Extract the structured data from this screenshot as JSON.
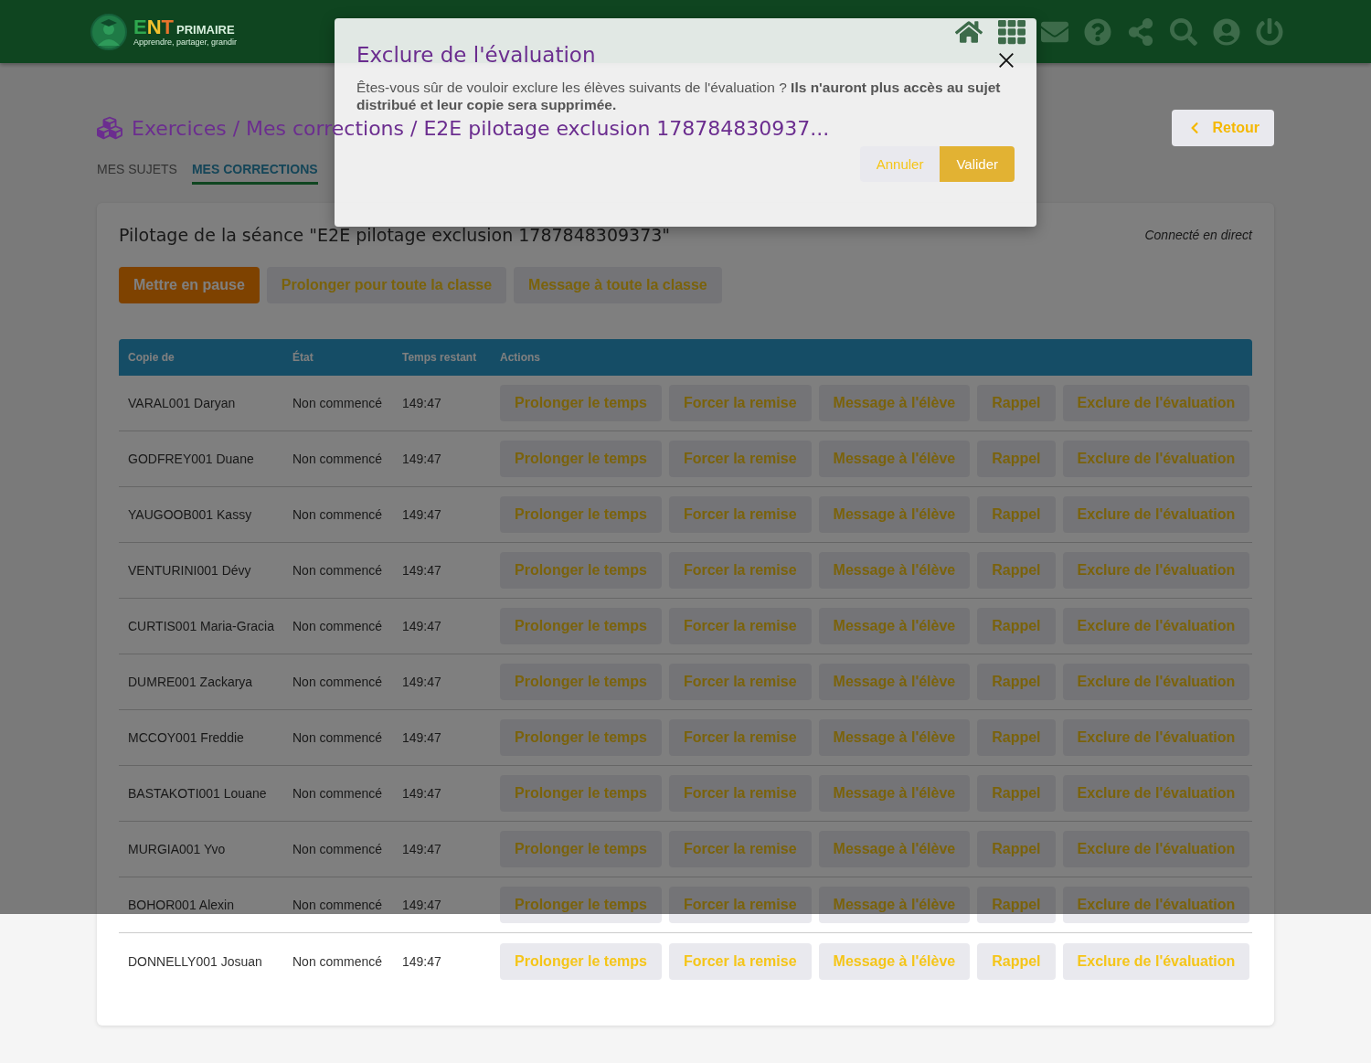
{
  "header": {
    "logo": {
      "letters": [
        {
          "text": "E",
          "color": "#2fa84f"
        },
        {
          "text": "N",
          "color": "#f2c12e"
        },
        {
          "text": "T",
          "color": "#e8742c"
        }
      ],
      "suffix": "PRIMAIRE",
      "tagline": "Apprendre, partager, grandir"
    },
    "icons": [
      {
        "kind": "home"
      },
      {
        "kind": "apps"
      },
      {
        "kind": "mail"
      },
      {
        "kind": "help"
      },
      {
        "kind": "share"
      },
      {
        "kind": "search"
      },
      {
        "kind": "user"
      },
      {
        "kind": "power"
      }
    ]
  },
  "breadcrumb": "Exercices / Mes corrections / E2E pilotage exclusion 178784830937...",
  "back_button": "Retour",
  "tabs": [
    {
      "label": "MES SUJETS",
      "selected": false
    },
    {
      "label": "MES CORRECTIONS",
      "selected": true
    }
  ],
  "session": {
    "title": "Pilotage de la séance \"E2E pilotage exclusion 1787848309373\"",
    "status": "Connecté en direct",
    "buttons": [
      {
        "label": "Mettre en pause",
        "kind": "primary"
      },
      {
        "label": "Prolonger pour toute la classe",
        "kind": "secondary"
      },
      {
        "label": "Message à toute la classe",
        "kind": "secondary"
      }
    ]
  },
  "table": {
    "columns": [
      "Copie de",
      "État",
      "Temps restant",
      "Actions"
    ],
    "rows": [
      {
        "student": "VARAL001 Daryan",
        "state": "Non commencé",
        "time": "149:47",
        "actions": [
          "Prolonger le temps",
          "Forcer la remise",
          "Message à l'élève",
          "Rappel",
          "Exclure de l'évaluation"
        ]
      },
      {
        "student": "GODFREY001 Duane",
        "state": "Non commencé",
        "time": "149:47",
        "actions": [
          "Prolonger le temps",
          "Forcer la remise",
          "Message à l'élève",
          "Rappel",
          "Exclure de l'évaluation"
        ]
      },
      {
        "student": "YAUGOOB001 Kassy",
        "state": "Non commencé",
        "time": "149:47",
        "actions": [
          "Prolonger le temps",
          "Forcer la remise",
          "Message à l'élève",
          "Rappel",
          "Exclure de l'évaluation"
        ]
      },
      {
        "student": "VENTURINI001 Dévy",
        "state": "Non commencé",
        "time": "149:47",
        "actions": [
          "Prolonger le temps",
          "Forcer la remise",
          "Message à l'élève",
          "Rappel",
          "Exclure de l'évaluation"
        ]
      },
      {
        "student": "CURTIS001 Maria-Gracia",
        "state": "Non commencé",
        "time": "149:47",
        "actions": [
          "Prolonger le temps",
          "Forcer la remise",
          "Message à l'élève",
          "Rappel",
          "Exclure de l'évaluation"
        ]
      },
      {
        "student": "DUMRE001 Zackarya",
        "state": "Non commencé",
        "time": "149:47",
        "actions": [
          "Prolonger le temps",
          "Forcer la remise",
          "Message à l'élève",
          "Rappel",
          "Exclure de l'évaluation"
        ]
      },
      {
        "student": "MCCOY001 Freddie",
        "state": "Non commencé",
        "time": "149:47",
        "actions": [
          "Prolonger le temps",
          "Forcer la remise",
          "Message à l'élève",
          "Rappel",
          "Exclure de l'évaluation"
        ]
      },
      {
        "student": "BASTAKOTI001 Louane",
        "state": "Non commencé",
        "time": "149:47",
        "actions": [
          "Prolonger le temps",
          "Forcer la remise",
          "Message à l'élève",
          "Rappel",
          "Exclure de l'évaluation"
        ]
      },
      {
        "student": "MURGIA001 Yvo",
        "state": "Non commencé",
        "time": "149:47",
        "actions": [
          "Prolonger le temps",
          "Forcer la remise",
          "Message à l'élève",
          "Rappel",
          "Exclure de l'évaluation"
        ]
      },
      {
        "student": "BOHOR001 Alexin",
        "state": "Non commencé",
        "time": "149:47",
        "actions": [
          "Prolonger le temps",
          "Forcer la remise",
          "Message à l'élève",
          "Rappel",
          "Exclure de l'évaluation"
        ]
      },
      {
        "student": "DONNELLY001 Josuan",
        "state": "Non commencé",
        "time": "149:47",
        "actions": [
          "Prolonger le temps",
          "Forcer la remise",
          "Message à l'élève",
          "Rappel",
          "Exclure de l'évaluation"
        ]
      }
    ]
  },
  "modal": {
    "title": "Exclure de l'évaluation",
    "message": "Êtes-vous sûr de vouloir exclure les élèves suivants de l'évaluation ? **Ils n'auront plus accès au sujet distribué et leur copie sera supprimée.**",
    "buttons": [
      {
        "label": "Annuler",
        "kind": "secondary"
      },
      {
        "label": "Valider",
        "kind": "primary"
      }
    ]
  }
}
